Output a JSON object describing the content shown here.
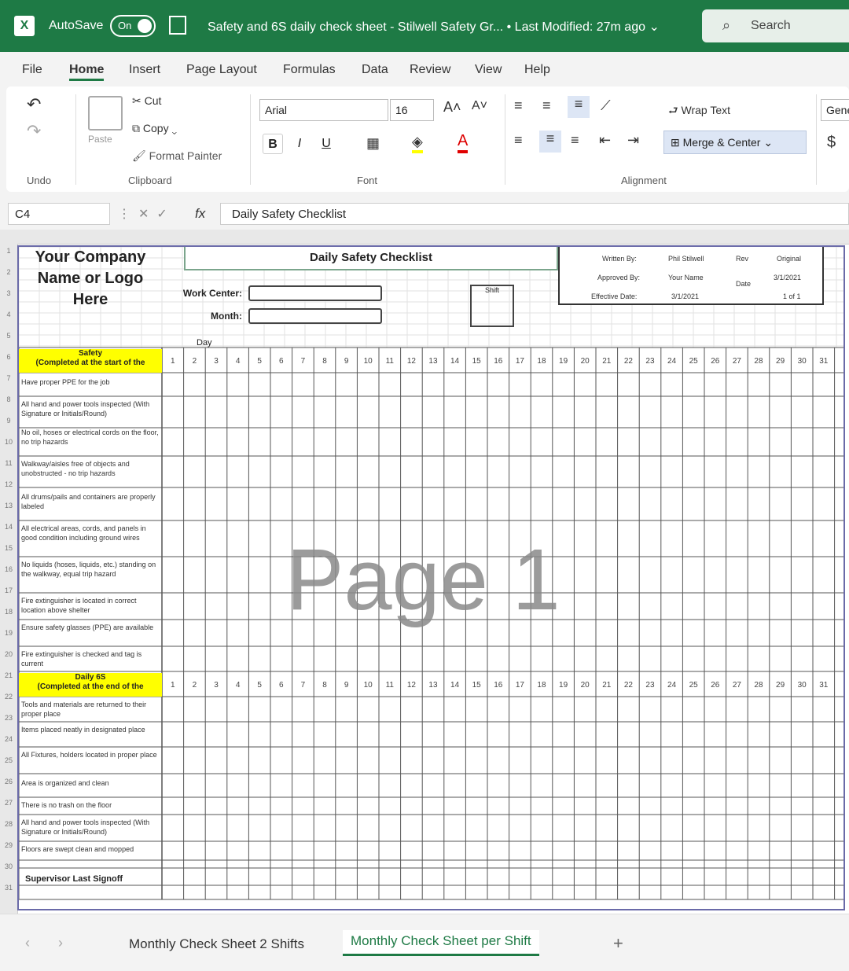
{
  "titlebar": {
    "autosave_label": "AutoSave",
    "toggle_state": "On",
    "doc_title": "Safety and 6S daily check sheet - Stilwell Safety Gr... • Last Modified: 27m ago ⌄",
    "search_label": "Search"
  },
  "menu": {
    "tabs": [
      "File",
      "Home",
      "Insert",
      "Page Layout",
      "Formulas",
      "Data",
      "Review",
      "View",
      "Help"
    ],
    "active": "Home"
  },
  "ribbon": {
    "undo_group": "Undo",
    "clipboard": {
      "paste": "Paste",
      "cut": "Cut",
      "copy": "Copy",
      "format_painter": "Format Painter",
      "group": "Clipboard"
    },
    "font": {
      "name": "Arial",
      "size": "16",
      "group": "Font",
      "bold": "B",
      "italic": "I",
      "underline": "U"
    },
    "alignment": {
      "wrap_text": "Wrap Text",
      "merge_center": "Merge & Center",
      "group": "Alignment"
    },
    "number": {
      "format": "Gene",
      "currency": "$"
    }
  },
  "formula_bar": {
    "cell_ref": "C4",
    "fx": "fx",
    "content": "Daily Safety Checklist"
  },
  "sheet": {
    "company_logo": [
      "Your Company",
      "Name or Logo",
      "Here"
    ],
    "title": "Daily Safety Checklist",
    "work_center_label": "Work Center:",
    "month_label": "Month:",
    "shift_label": "Shift",
    "info_table": [
      {
        "label": "Written By:",
        "value": "Phil Stilwell",
        "extra_label": "Rev",
        "extra_value": "Original"
      },
      {
        "label": "Approved By:",
        "value": "Your Name",
        "extra_label": "Date",
        "extra_value": "3/1/2021"
      },
      {
        "label": "Effective Date:",
        "value": "3/1/2021",
        "extra_label": "",
        "extra_value": "1 of 1"
      }
    ],
    "day_label": "Day",
    "days": [
      "1",
      "2",
      "3",
      "4",
      "5",
      "6",
      "7",
      "8",
      "9",
      "10",
      "11",
      "12",
      "13",
      "14",
      "15",
      "16",
      "17",
      "18",
      "19",
      "20",
      "21",
      "22",
      "23",
      "24",
      "25",
      "26",
      "27",
      "28",
      "29",
      "30",
      "31"
    ],
    "safety_header": [
      "Safety",
      "(Completed at the start of the"
    ],
    "safety_items": [
      "Have proper PPE for the job",
      "All hand and power tools inspected (With Signature or Initials/Round)",
      "No oil, hoses or electrical cords on the floor, no trip hazards",
      "Walkway/aisles free of objects and unobstructed - no trip hazards",
      "All drums/pails and containers are properly labeled",
      "All electrical areas, cords, and panels in good condition including ground wires",
      "No liquids (hoses, liquids, etc.) standing on the walkway, equal trip hazard",
      "Fire extinguisher is located in correct location above shelter",
      "Ensure safety glasses (PPE) are available",
      "Fire extinguisher is checked and tag is current"
    ],
    "sixs_header": [
      "Daily 6S",
      "(Completed at the end of the"
    ],
    "sixs_items": [
      "Tools and materials are returned to their proper place",
      "Items placed neatly in designated place",
      "All Fixtures, holders located in proper place",
      "Area is organized and clean",
      "There is no trash on the floor",
      "All hand and power tools inspected (With Signature or Initials/Round)",
      "Floors are swept clean and mopped"
    ],
    "signoff_label": "Supervisor Last Signoff",
    "watermark": "Page 1",
    "row_numbers": [
      "1",
      "2",
      "3",
      "4",
      "5",
      "6",
      "7",
      "8",
      "9",
      "10",
      "11",
      "12",
      "13",
      "14",
      "15",
      "16",
      "17",
      "18",
      "19",
      "20",
      "21",
      "22",
      "23",
      "24",
      "25",
      "26",
      "27",
      "28",
      "29",
      "30",
      "31"
    ]
  },
  "sheet_tabs": {
    "tabs": [
      "Monthly Check Sheet 2 Shifts",
      "Monthly Check Sheet per Shift"
    ],
    "active": "Monthly Check Sheet per Shift",
    "add": "+"
  },
  "colors": {
    "excel_green": "#1e7a45",
    "highlight_yellow": "#ffff00",
    "page_border": "#6a6aa8"
  }
}
